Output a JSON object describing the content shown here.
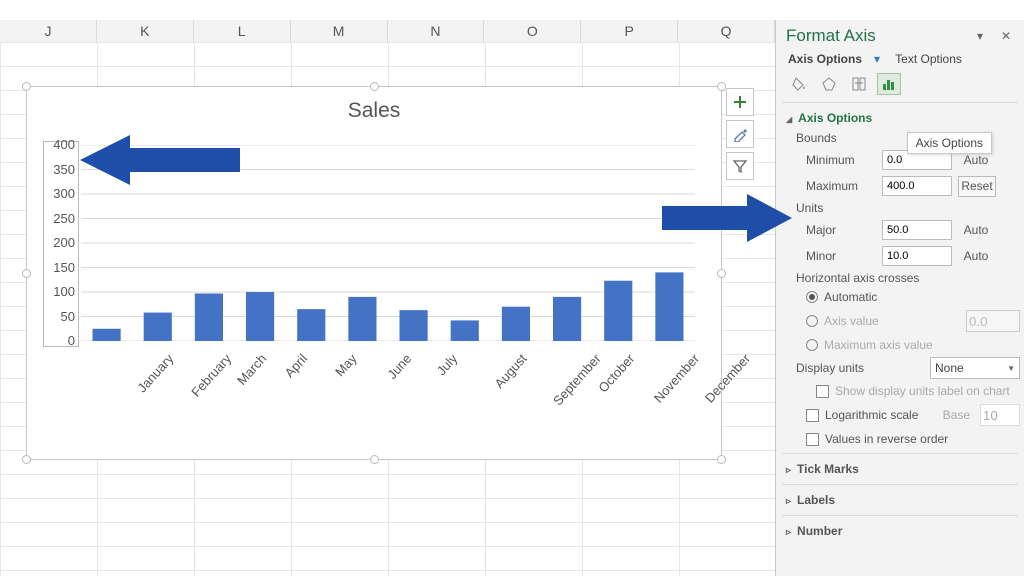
{
  "columns": [
    "J",
    "K",
    "L",
    "M",
    "N",
    "O",
    "P",
    "Q"
  ],
  "chart_buttons": {
    "plus": "+",
    "brush": "brush",
    "filter": "filter"
  },
  "pane": {
    "title": "Format Axis",
    "tabs": {
      "options": "Axis Options",
      "text": "Text Options"
    },
    "tooltip": "Axis Options",
    "sections": {
      "axis_options": "Axis Options",
      "bounds": "Bounds",
      "min_label": "Minimum",
      "min_value": "0.0",
      "min_tail": "Auto",
      "max_label": "Maximum",
      "max_value": "400.0",
      "max_tail": "Reset",
      "units": "Units",
      "major_label": "Major",
      "major_value": "50.0",
      "major_tail": "Auto",
      "minor_label": "Minor",
      "minor_value": "10.0",
      "minor_tail": "Auto",
      "hcross": "Horizontal axis crosses",
      "hc_auto": "Automatic",
      "hc_axisval": "Axis value",
      "hc_axisval_val": "0.0",
      "hc_maxval": "Maximum axis value",
      "dunits": "Display units",
      "dunits_val": "None",
      "dunits_chk": "Show display units label on chart",
      "log": "Logarithmic scale",
      "log_base_lab": "Base",
      "log_base_val": "10",
      "reverse": "Values in reverse order",
      "tick": "Tick Marks",
      "labels": "Labels",
      "number": "Number"
    }
  },
  "chart_data": {
    "type": "bar",
    "title": "Sales",
    "xlabel": "",
    "ylabel": "",
    "ylim": [
      0,
      400
    ],
    "ystep": 50,
    "categories": [
      "January",
      "February",
      "March",
      "April",
      "May",
      "June",
      "July",
      "August",
      "September",
      "October",
      "November",
      "December"
    ],
    "values": [
      25,
      58,
      97,
      100,
      65,
      90,
      63,
      42,
      70,
      90,
      123,
      140
    ]
  }
}
